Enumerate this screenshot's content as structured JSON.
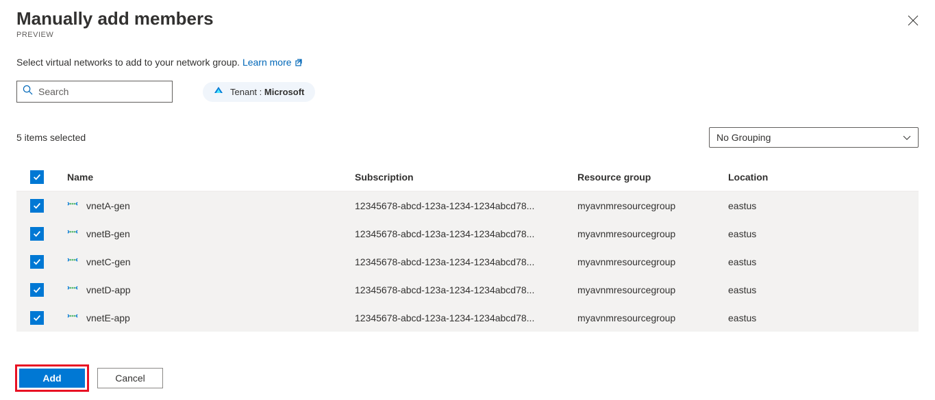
{
  "header": {
    "title": "Manually add members",
    "preview": "PREVIEW"
  },
  "description": "Select virtual networks to add to your network group.",
  "learnMore": "Learn more",
  "search": {
    "placeholder": "Search"
  },
  "tenant": {
    "label": "Tenant :",
    "value": "Microsoft"
  },
  "selectionText": "5 items selected",
  "grouping": "No Grouping",
  "columns": {
    "name": "Name",
    "subscription": "Subscription",
    "resourceGroup": "Resource group",
    "location": "Location"
  },
  "rows": [
    {
      "name": "vnetA-gen",
      "subscription": "12345678-abcd-123a-1234-1234abcd78...",
      "resourceGroup": "myavnmresourcegroup",
      "location": "eastus"
    },
    {
      "name": "vnetB-gen",
      "subscription": "12345678-abcd-123a-1234-1234abcd78...",
      "resourceGroup": "myavnmresourcegroup",
      "location": "eastus"
    },
    {
      "name": "vnetC-gen",
      "subscription": "12345678-abcd-123a-1234-1234abcd78...",
      "resourceGroup": "myavnmresourcegroup",
      "location": "eastus"
    },
    {
      "name": "vnetD-app",
      "subscription": "12345678-abcd-123a-1234-1234abcd78...",
      "resourceGroup": "myavnmresourcegroup",
      "location": "eastus"
    },
    {
      "name": "vnetE-app",
      "subscription": "12345678-abcd-123a-1234-1234abcd78...",
      "resourceGroup": "myavnmresourcegroup",
      "location": "eastus"
    }
  ],
  "footer": {
    "add": "Add",
    "cancel": "Cancel"
  }
}
